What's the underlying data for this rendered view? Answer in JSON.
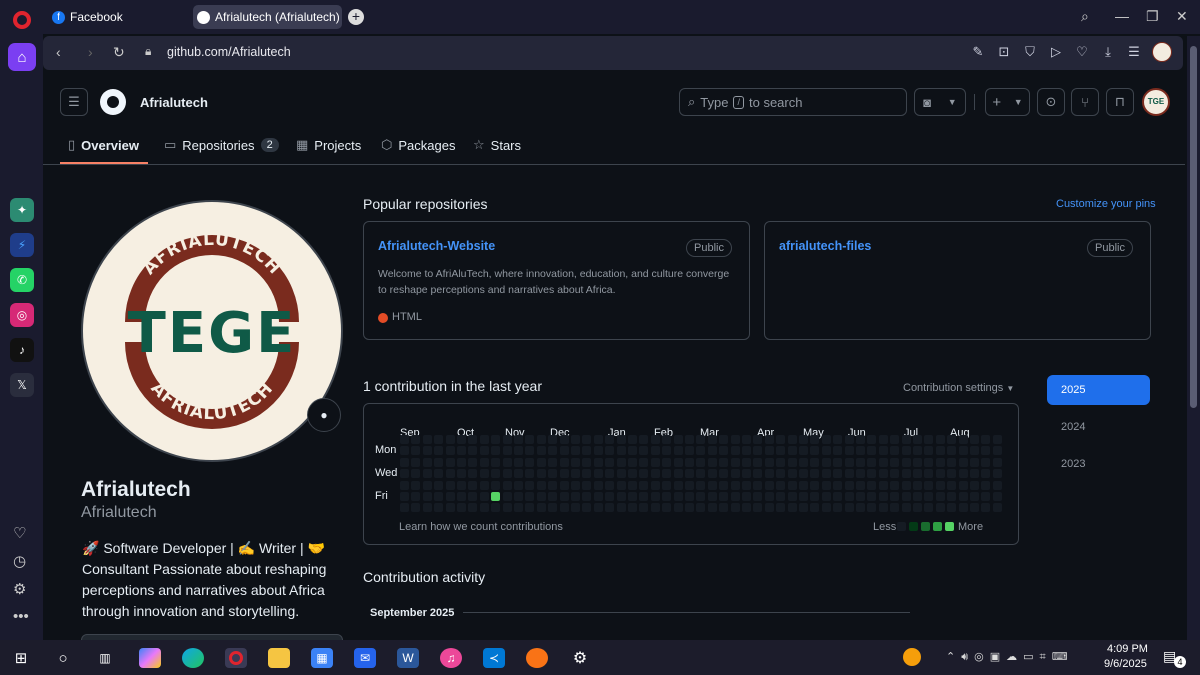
{
  "tabs": [
    {
      "label": "Facebook"
    },
    {
      "label": "Afrialutech (Afrialutech)"
    }
  ],
  "address": {
    "url": "github.com/Afrialutech"
  },
  "header": {
    "username": "Afrialutech",
    "search_type": "Type",
    "search_key": "/",
    "search_rest": "to search"
  },
  "nav": {
    "overview": "Overview",
    "repositories": "Repositories",
    "repo_count": "2",
    "projects": "Projects",
    "packages": "Packages",
    "stars": "Stars"
  },
  "avatar": {
    "top_text": "AFRIALUTECH",
    "middle_text": "TEGE",
    "bottom_text": "AFRIALUTECH"
  },
  "profile": {
    "name": "Afrialutech",
    "login": "Afrialutech",
    "bio_line1": "🚀 Software Developer | ✍️ Writer | 🤝",
    "bio_line2": "Consultant Passionate about reshaping",
    "bio_line3": "perceptions and narratives about Africa",
    "bio_line4": "through innovation and storytelling."
  },
  "popular": {
    "title": "Popular repositories",
    "customize": "Customize your pins",
    "repos": [
      {
        "name": "Afrialutech-Website",
        "visibility": "Public",
        "desc_line1": "Welcome to AfriAluTech, where innovation, education, and culture converge",
        "desc_line2": "to reshape perceptions and narratives about Africa.",
        "language": "HTML",
        "language_color": "#e34c26"
      },
      {
        "name": "afrialutech-files",
        "visibility": "Public"
      }
    ]
  },
  "contrib": {
    "title": "1 contribution in the last year",
    "settings": "Contribution settings",
    "months": [
      "Sep",
      "Oct",
      "Nov",
      "Dec",
      "Jan",
      "Feb",
      "Mar",
      "Apr",
      "May",
      "Jun",
      "Jul",
      "Aug"
    ],
    "days": [
      "Mon",
      "Wed",
      "Fri"
    ],
    "learn": "Learn how we count contributions",
    "less": "Less",
    "more": "More",
    "active_week": 8,
    "active_day": 5,
    "empty_color": "#151b23",
    "level_colors": [
      "#151b23",
      "#033a16",
      "#196c2e",
      "#2ea043",
      "#56d364"
    ],
    "years": [
      "2025",
      "2024",
      "2023"
    ],
    "selected_year": "2025"
  },
  "activity": {
    "title": "Contribution activity",
    "month": "September 2025"
  },
  "taskbar": {
    "time": "4:09 PM",
    "date": "9/6/2025",
    "notif_count": "4"
  },
  "colors": {
    "link": "#4493f8",
    "accent_underline": "#f78166",
    "year_selected": "#1f6feb"
  }
}
